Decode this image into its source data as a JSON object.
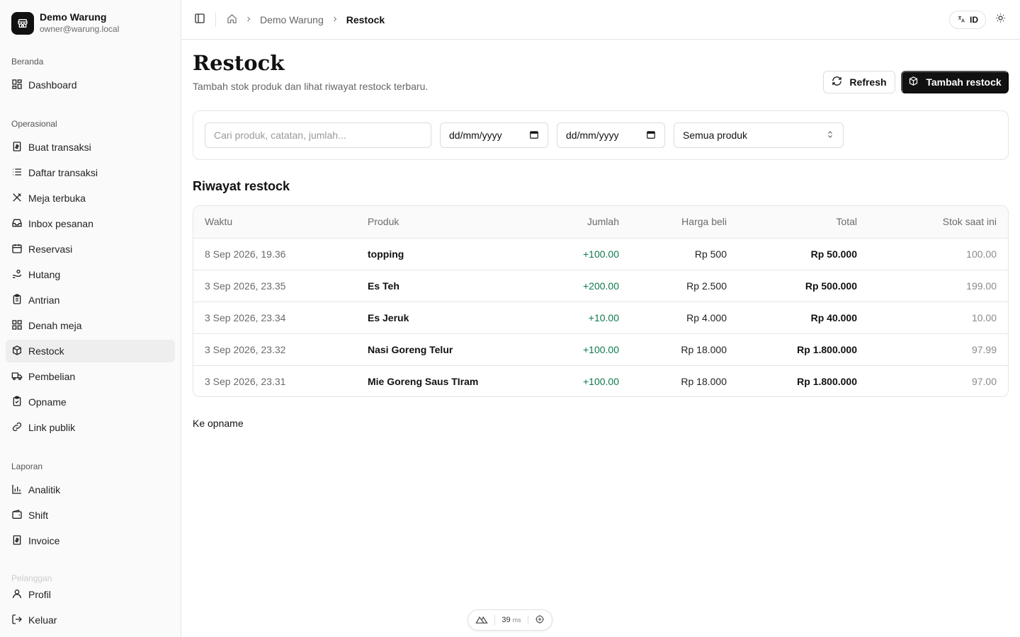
{
  "brand": {
    "name": "Demo Warung",
    "email": "owner@warung.local"
  },
  "sidebar": {
    "groups": [
      {
        "label": "Beranda"
      },
      {
        "label": "Operasional"
      },
      {
        "label": "Laporan"
      },
      {
        "label": "Pelanggan"
      }
    ],
    "items": [
      {
        "label": "Dashboard",
        "icon": "dashboard-icon"
      },
      {
        "label": "Buat transaksi",
        "icon": "receipt-icon"
      },
      {
        "label": "Daftar transaksi",
        "icon": "list-icon"
      },
      {
        "label": "Meja terbuka",
        "icon": "utensils-icon"
      },
      {
        "label": "Inbox pesanan",
        "icon": "inbox-icon"
      },
      {
        "label": "Reservasi",
        "icon": "calendar-icon"
      },
      {
        "label": "Hutang",
        "icon": "hand-coins-icon"
      },
      {
        "label": "Antrian",
        "icon": "clipboard-icon"
      },
      {
        "label": "Denah meja",
        "icon": "grid-icon"
      },
      {
        "label": "Restock",
        "icon": "package-plus-icon"
      },
      {
        "label": "Pembelian",
        "icon": "truck-icon"
      },
      {
        "label": "Opname",
        "icon": "clipboard-check-icon"
      },
      {
        "label": "Link publik",
        "icon": "link-icon"
      },
      {
        "label": "Analitik",
        "icon": "bar-chart-icon"
      },
      {
        "label": "Shift",
        "icon": "wallet-icon"
      },
      {
        "label": "Invoice",
        "icon": "receipt-icon"
      },
      {
        "label": "Profil",
        "icon": "user-icon"
      },
      {
        "label": "Keluar",
        "icon": "logout-icon"
      }
    ],
    "active": "Restock"
  },
  "topbar": {
    "breadcrumb": [
      "Demo Warung",
      "Restock"
    ],
    "language": "ID"
  },
  "page": {
    "title": "Restock",
    "subtitle": "Tambah stok produk dan lihat riwayat restock terbaru.",
    "refresh_label": "Refresh",
    "add_label": "Tambah restock"
  },
  "filters": {
    "search_placeholder": "Cari produk, catatan, jumlah...",
    "date_from": "dd/mm/yyyy",
    "date_to": "dd/mm/yyyy",
    "product_select": "Semua produk"
  },
  "history": {
    "title": "Riwayat restock",
    "columns": [
      "Waktu",
      "Produk",
      "Jumlah",
      "Harga beli",
      "Total",
      "Stok saat ini"
    ],
    "rows": [
      {
        "time": "8 Sep 2026, 19.36",
        "product": "topping",
        "qty": "+100.00",
        "price": "Rp 500",
        "total": "Rp 50.000",
        "stock": "100.00"
      },
      {
        "time": "3 Sep 2026, 23.35",
        "product": "Es Teh",
        "qty": "+200.00",
        "price": "Rp 2.500",
        "total": "Rp 500.000",
        "stock": "199.00"
      },
      {
        "time": "3 Sep 2026, 23.34",
        "product": "Es Jeruk",
        "qty": "+10.00",
        "price": "Rp 4.000",
        "total": "Rp 40.000",
        "stock": "10.00"
      },
      {
        "time": "3 Sep 2026, 23.32",
        "product": "Nasi Goreng Telur",
        "qty": "+100.00",
        "price": "Rp 18.000",
        "total": "Rp 1.800.000",
        "stock": "97.99"
      },
      {
        "time": "3 Sep 2026, 23.31",
        "product": "Mie Goreng Saus TIram",
        "qty": "+100.00",
        "price": "Rp 18.000",
        "total": "Rp 1.800.000",
        "stock": "97.00"
      }
    ]
  },
  "footer_link": "Ke opname",
  "devbar": {
    "ms_value": "39",
    "ms_unit": "ms"
  },
  "colors": {
    "accent": "#111111",
    "positive": "#0f7a4d",
    "active_nav": "#eeeeee"
  }
}
